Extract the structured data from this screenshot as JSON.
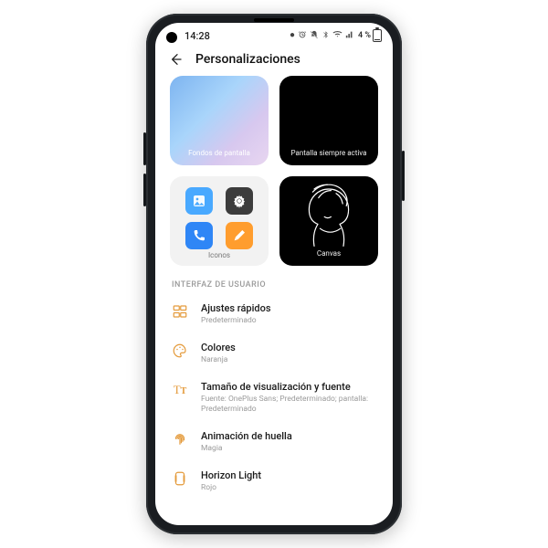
{
  "status": {
    "time": "14:28",
    "battery_pct": "4 %"
  },
  "header": {
    "title": "Personalizaciones"
  },
  "tiles": {
    "wallpapers": "Fondos de pantalla",
    "aod": "Pantalla siempre activa",
    "icons": "Iconos",
    "canvas": "Canvas"
  },
  "section": {
    "ui": "INTERFAZ DE USUARIO"
  },
  "rows": {
    "quick": {
      "title": "Ajustes rápidos",
      "sub": "Predeterminado"
    },
    "colors": {
      "title": "Colores",
      "sub": "Naranja"
    },
    "font": {
      "title": "Tamaño de visualización y fuente",
      "sub": "Fuente: OnePlus Sans; Predeterminado; pantalla: Predeterminado"
    },
    "fp": {
      "title": "Animación de huella",
      "sub": "Magia"
    },
    "horizon": {
      "title": "Horizon Light",
      "sub": "Rojo"
    }
  }
}
